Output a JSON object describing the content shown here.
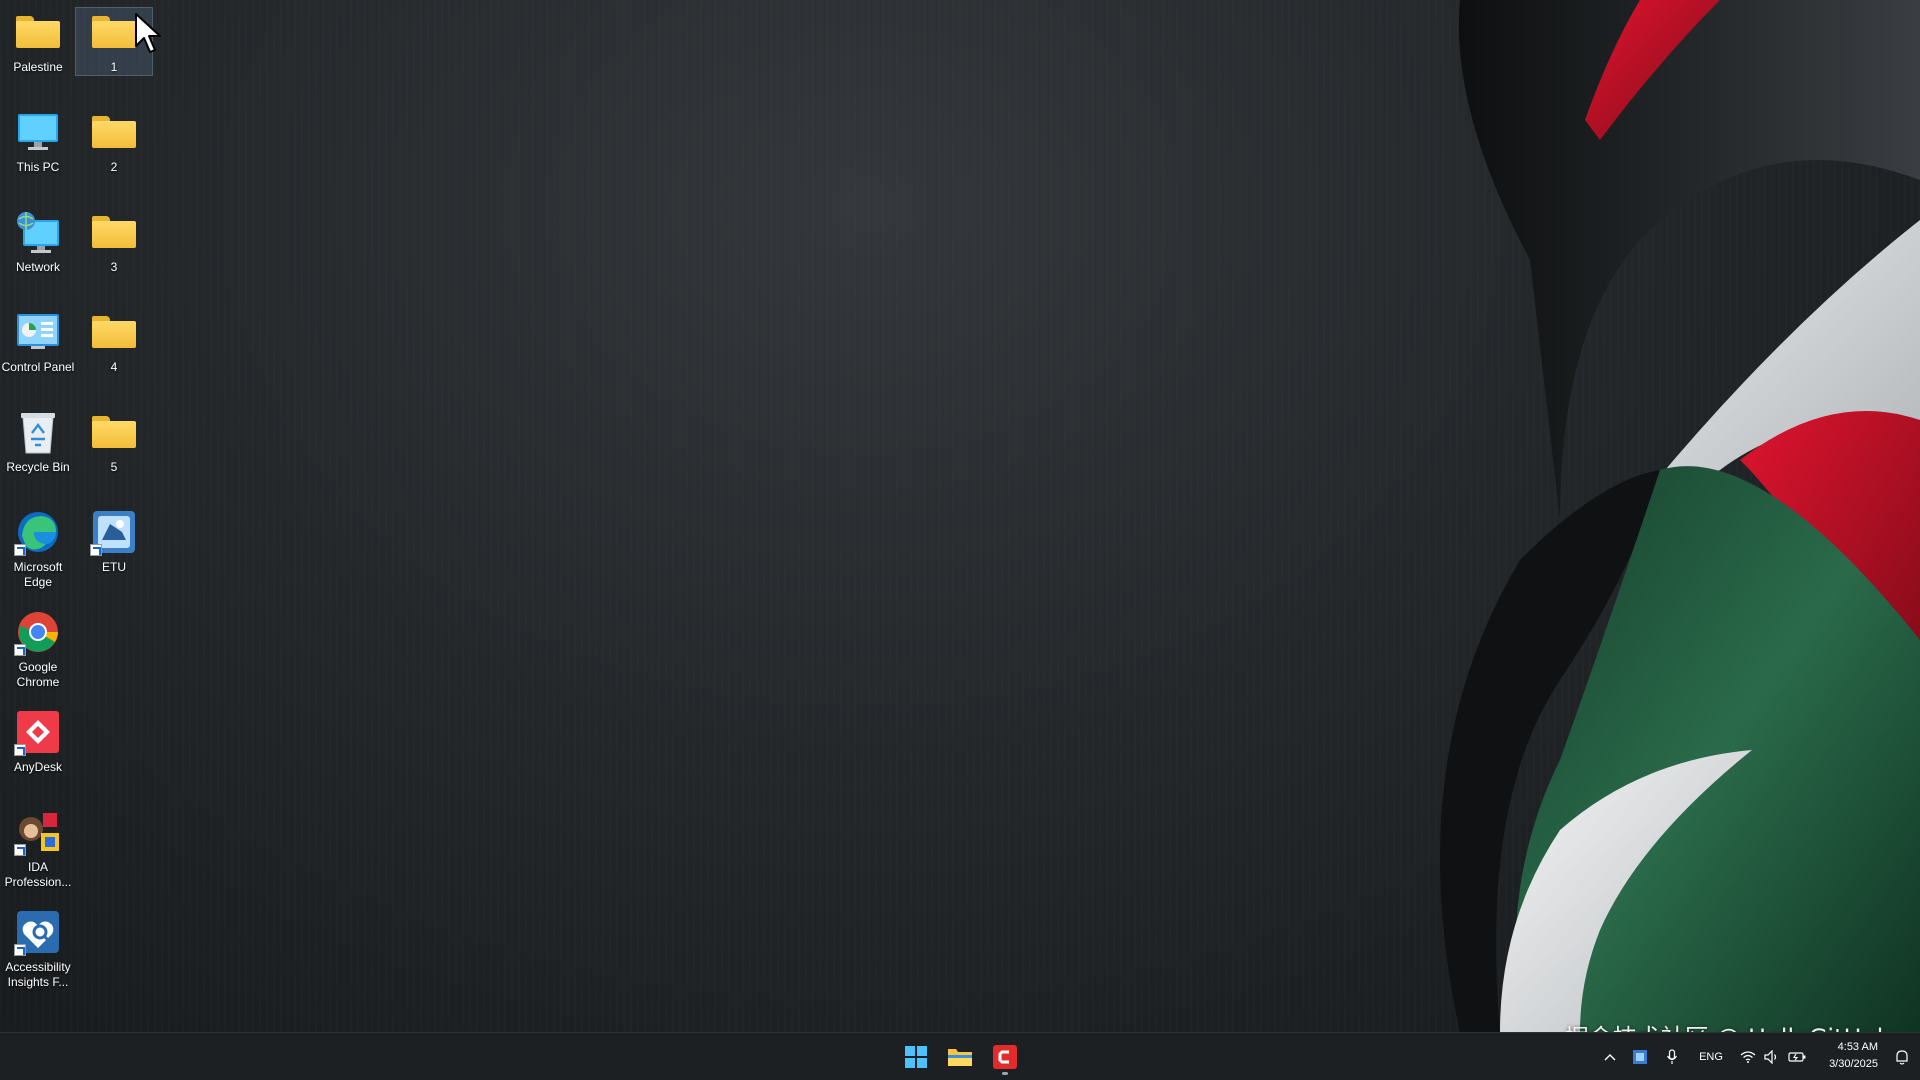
{
  "desktop": {
    "icons": [
      {
        "label": "Palestine",
        "type": "folder"
      },
      {
        "label": "1",
        "type": "folder"
      },
      {
        "label": "This PC",
        "type": "this-pc"
      },
      {
        "label": "2",
        "type": "folder"
      },
      {
        "label": "Network",
        "type": "network"
      },
      {
        "label": "3",
        "type": "folder"
      },
      {
        "label": "Control Panel",
        "type": "control-panel"
      },
      {
        "label": "4",
        "type": "folder"
      },
      {
        "label": "Recycle Bin",
        "type": "recycle-bin"
      },
      {
        "label": "5",
        "type": "folder"
      },
      {
        "label": "Microsoft Edge",
        "type": "edge"
      },
      {
        "label": "ETU",
        "type": "etu"
      },
      {
        "label": "Google Chrome",
        "type": "chrome"
      },
      {
        "label": "AnyDesk",
        "type": "anydesk"
      },
      {
        "label": "IDA Profession...",
        "type": "ida"
      },
      {
        "label": "Accessibility Insights F...",
        "type": "accessibility"
      }
    ]
  },
  "taskbar": {
    "pinned": [
      {
        "name": "start",
        "icon": "windows-logo-icon"
      },
      {
        "name": "file-explorer",
        "icon": "folder-icon"
      },
      {
        "name": "app-c",
        "icon": "red-c-icon"
      }
    ],
    "tray": {
      "language": "ENG",
      "time": "4:53 AM",
      "date": "3/30/2025"
    }
  },
  "watermark": "掘金技术社区 @ HelloGitHub",
  "colors": {
    "taskbar_bg": "#1d2023",
    "folder": "#f2bd3a",
    "flag_red": "#c8102e",
    "flag_green": "#1f5c3f",
    "flag_white": "#e6e8ea"
  }
}
